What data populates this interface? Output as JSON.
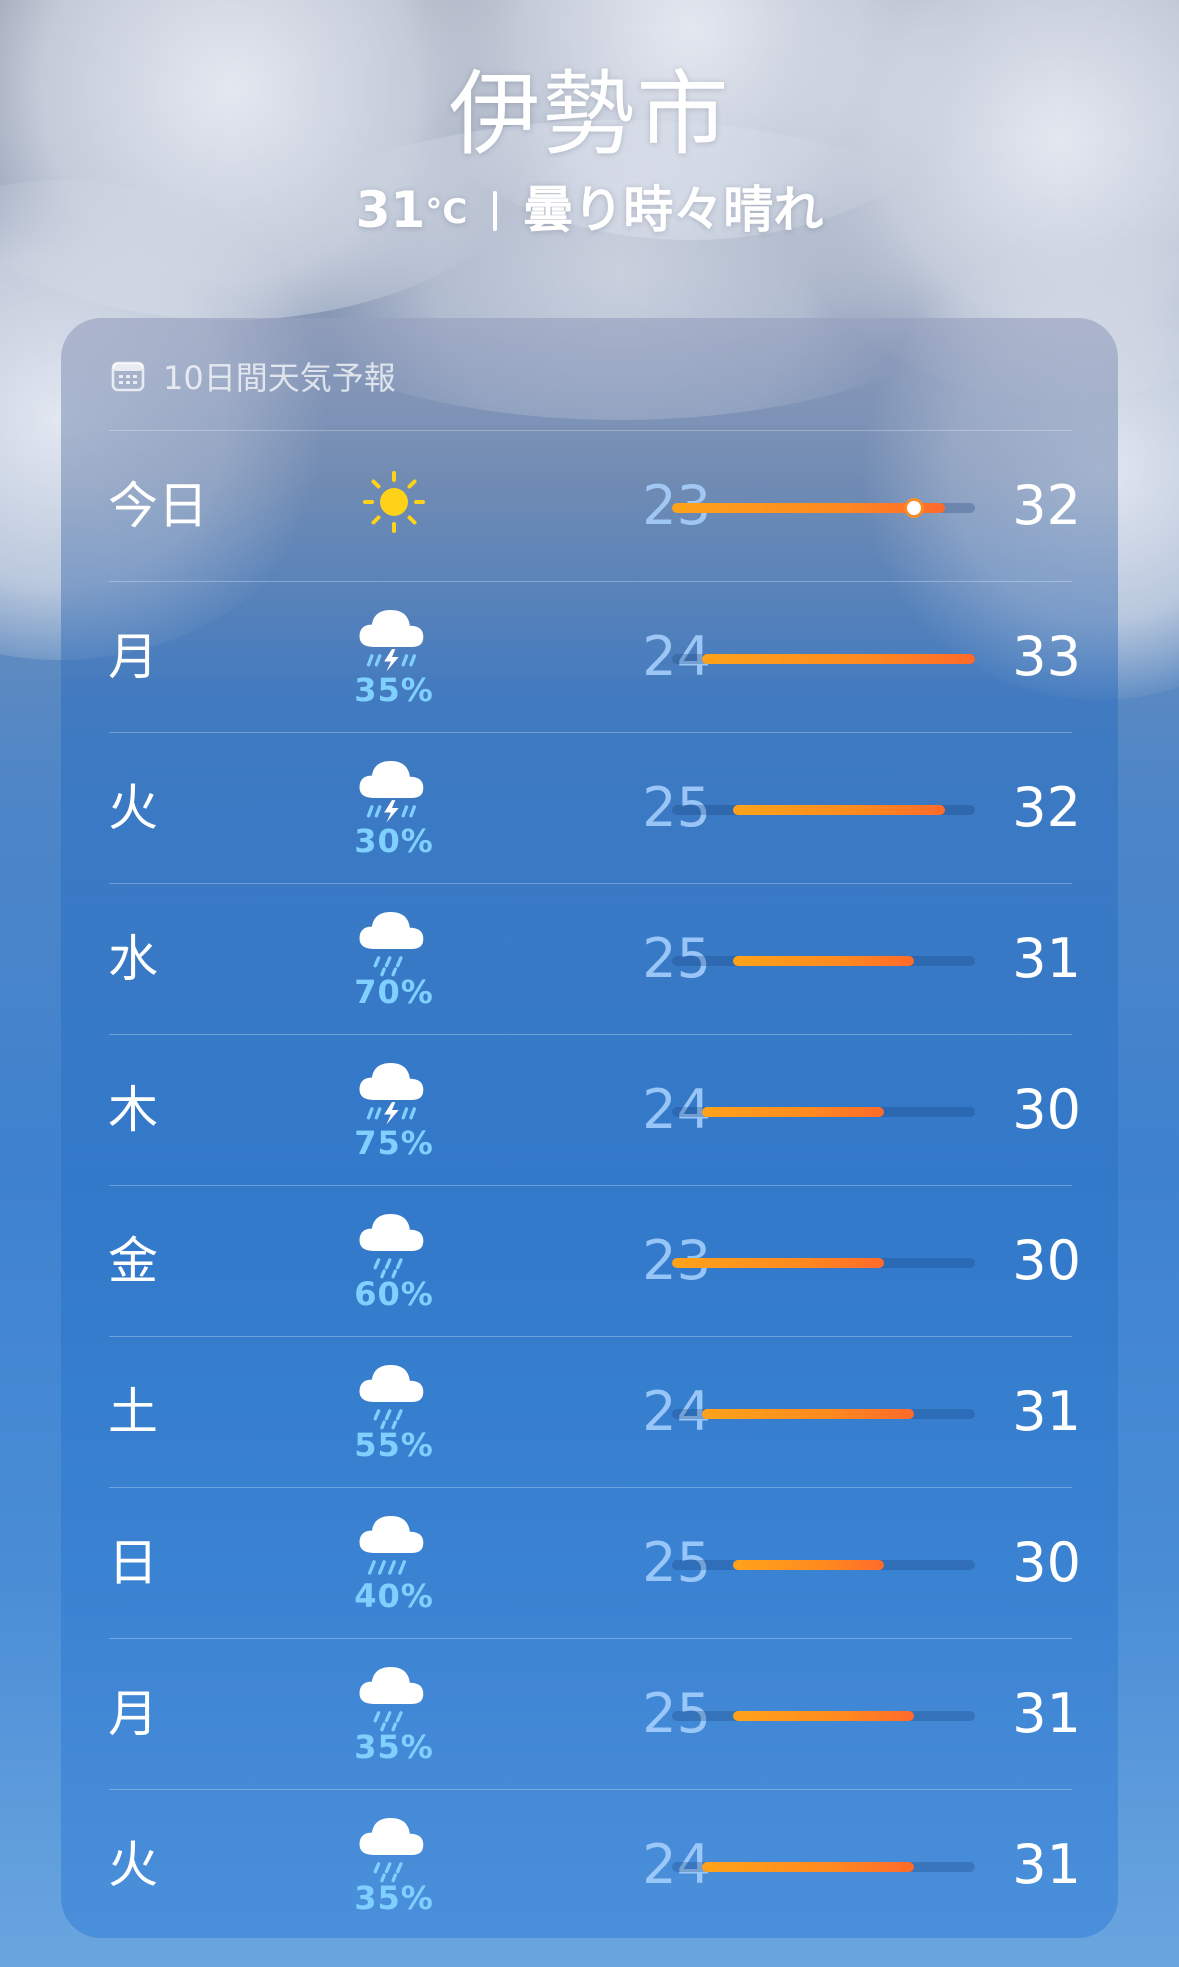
{
  "location": {
    "city": "伊勢市",
    "temperature": "31",
    "unit": "°C",
    "condition": "曇り時々晴れ"
  },
  "forecast": {
    "title": "10日間天気予報",
    "range": {
      "min": 23,
      "max": 33
    },
    "current_temperature": 31,
    "days": [
      {
        "day": "今日",
        "icon": "sun-icon",
        "precip": "",
        "low": "23",
        "high": "32",
        "lo": 23,
        "hi": 32
      },
      {
        "day": "月",
        "icon": "thunderstorm-icon",
        "precip": "35%",
        "low": "24",
        "high": "33",
        "lo": 24,
        "hi": 33
      },
      {
        "day": "火",
        "icon": "thunderstorm-icon",
        "precip": "30%",
        "low": "25",
        "high": "32",
        "lo": 25,
        "hi": 32
      },
      {
        "day": "水",
        "icon": "rain-cloud-icon",
        "precip": "70%",
        "low": "25",
        "high": "31",
        "lo": 25,
        "hi": 31
      },
      {
        "day": "木",
        "icon": "thunderstorm-icon",
        "precip": "75%",
        "low": "24",
        "high": "30",
        "lo": 24,
        "hi": 30
      },
      {
        "day": "金",
        "icon": "rain-cloud-icon",
        "precip": "60%",
        "low": "23",
        "high": "30",
        "lo": 23,
        "hi": 30
      },
      {
        "day": "土",
        "icon": "rain-cloud-icon",
        "precip": "55%",
        "low": "24",
        "high": "31",
        "lo": 24,
        "hi": 31
      },
      {
        "day": "日",
        "icon": "heavy-rain-cloud-icon",
        "precip": "40%",
        "low": "25",
        "high": "30",
        "lo": 25,
        "hi": 30
      },
      {
        "day": "月",
        "icon": "rain-cloud-icon",
        "precip": "35%",
        "low": "25",
        "high": "31",
        "lo": 25,
        "hi": 31
      },
      {
        "day": "火",
        "icon": "rain-cloud-icon",
        "precip": "35%",
        "low": "24",
        "high": "31",
        "lo": 24,
        "hi": 31
      }
    ]
  }
}
